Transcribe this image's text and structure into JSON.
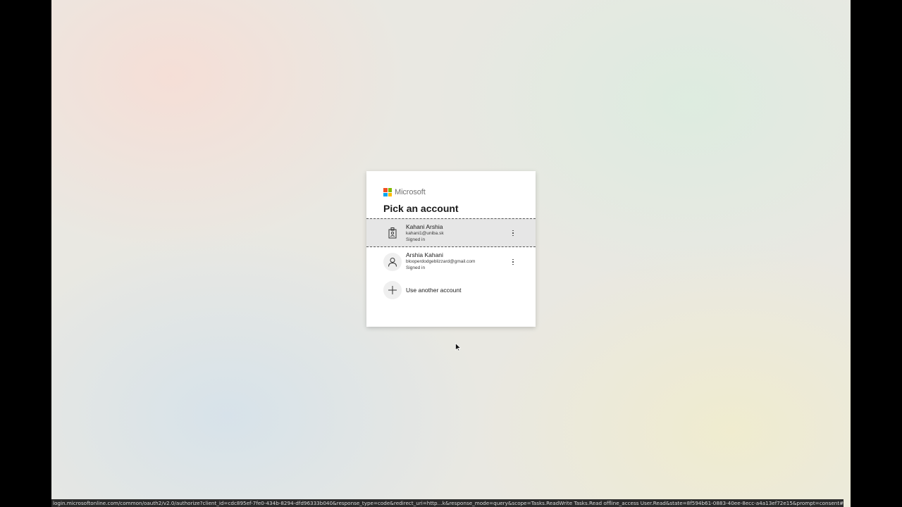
{
  "brand": {
    "name": "Microsoft",
    "logo_colors": [
      "#f25022",
      "#7fba00",
      "#00a4ef",
      "#ffb900"
    ]
  },
  "dialog": {
    "title": "Pick an account",
    "accounts": [
      {
        "name": "Kahani Arshia",
        "email": "kahani1@uniba.sk",
        "status": "Signed in",
        "icon": "work-badge-icon",
        "selected": true
      },
      {
        "name": "Arshia Kahani",
        "email": "blooperdodgeblizzard@gmail.com",
        "status": "Signed in",
        "icon": "person-icon",
        "selected": false
      }
    ],
    "use_another_label": "Use another account",
    "more_options_icon": "more-vertical-icon"
  },
  "status_bar": {
    "url": "login.microsoftonline.com/common/oauth2/v2.0/authorize?client_id=cdc895ef-7fe0-434b-8294-dfd96333b040&response_type=code&redirect_uri=http…k&response_mode=query&scope=Tasks.ReadWrite Tasks.Read offline_access User.Read&state=8f594b61-0883-40ee-8ecc-a4a13ef72e15&prompt=consent#"
  },
  "colors": {
    "selected_tile_bg": "#e6e6e6",
    "card_bg": "#ffffff",
    "title_text": "#1b1b1b"
  }
}
